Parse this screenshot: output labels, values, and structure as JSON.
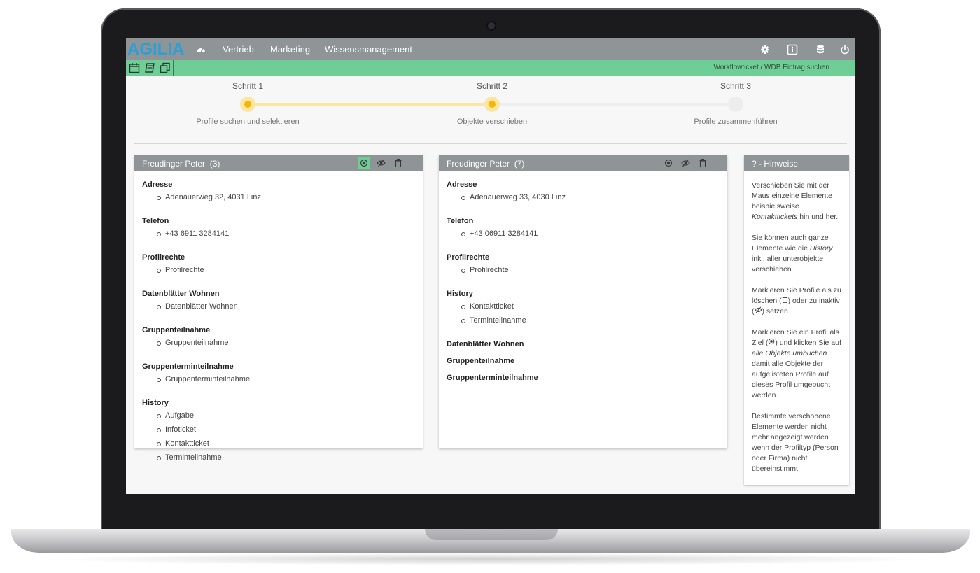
{
  "app": {
    "logo": "AGILIA",
    "nav": [
      "Vertrieb",
      "Marketing",
      "Wissensmanagement"
    ],
    "right_icons": [
      "gear-icon",
      "info-icon",
      "database-icon",
      "power-icon"
    ]
  },
  "toolbar": {
    "icons": [
      "calendar-icon",
      "book-icon",
      "copy-icon"
    ],
    "breadcrumb": "Workflowticket / WDB Eintrag suchen ..."
  },
  "stepper": {
    "steps": [
      {
        "title": "Schritt 1",
        "desc": "Profile suchen und selektieren",
        "state": "done"
      },
      {
        "title": "Schritt 2",
        "desc": "Objekte verschieben",
        "state": "current"
      },
      {
        "title": "Schritt 3",
        "desc": "Profile zusammenführen",
        "state": "pending"
      }
    ]
  },
  "profiles": [
    {
      "name": "Freudinger Peter",
      "count": "(3)",
      "target_selected": true,
      "sections": [
        {
          "title": "Adresse",
          "items": [
            "Adenauerweg 32, 4031 Linz"
          ]
        },
        {
          "title": "Telefon",
          "items": [
            "+43 6911 3284141"
          ]
        },
        {
          "title": "Profilrechte",
          "items": [
            "Profilrechte"
          ]
        },
        {
          "title": "Datenblätter Wohnen",
          "items": [
            "Datenblätter Wohnen"
          ]
        },
        {
          "title": "Gruppenteilnahme",
          "items": [
            "Gruppenteilnahme"
          ]
        },
        {
          "title": "Gruppenterminteilnahme",
          "items": [
            "Gruppenterminteilnahme"
          ]
        },
        {
          "title": "History",
          "items": [
            "Aufgabe",
            "Infoticket",
            "Kontaktticket",
            "Terminteilnahme"
          ]
        }
      ]
    },
    {
      "name": "Freudinger Peter",
      "count": "(7)",
      "target_selected": false,
      "sections": [
        {
          "title": "Adresse",
          "items": [
            "Adenauerweg 33, 4030 Linz"
          ]
        },
        {
          "title": "Telefon",
          "items": [
            "+43 06911 3284141"
          ]
        },
        {
          "title": "Profilrechte",
          "items": [
            "Profilrechte"
          ]
        },
        {
          "title": "History",
          "items": [
            "Kontaktticket",
            "Terminteilnahme"
          ]
        },
        {
          "title": "Datenblätter Wohnen",
          "items": []
        },
        {
          "title": "Gruppenteilnahme",
          "items": []
        },
        {
          "title": "Gruppenterminteilnahme",
          "items": []
        }
      ]
    }
  ],
  "hints": {
    "title": "?  -  Hinweise",
    "p1_a": "Verschieben Sie mit der Maus einzelne Elemente beispielsweise ",
    "p1_em": "Kontakttickets",
    "p1_b": " hin und her.",
    "p2_a": "Sie können auch ganze Elemente wie die ",
    "p2_em": "History",
    "p2_b": " inkl. aller unterobjekte verschieben.",
    "p3_a": "Markieren Sie Profile als zu löschen (",
    "p3_b": ") oder zu inaktiv (",
    "p3_c": ") setzen.",
    "p4_a": "Markieren Sie ein Profil als Ziel (",
    "p4_b": ") und klicken Sie auf ",
    "p4_em": "alle Objekte umbuchen",
    "p4_c": " damit alle Objekte der aufgelisteten Profile auf dieses Profil umgebucht werden.",
    "p5": "Bestimmte verschobene Elemente werden nicht mehr angezeigt werden wenn der Profiltyp (Person oder Firma) nicht übereinstimmt."
  }
}
